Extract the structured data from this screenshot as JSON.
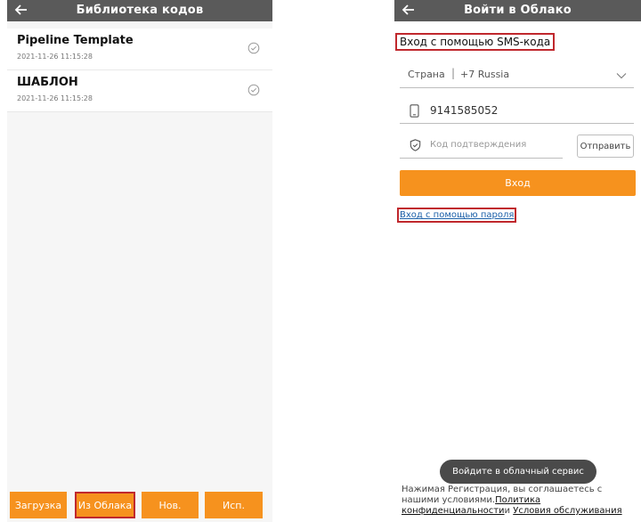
{
  "left": {
    "header": {
      "title": "Библиотека кодов"
    },
    "items": [
      {
        "title": "Pipeline Template",
        "date": "2021-11-26 11:15:28"
      },
      {
        "title": "ШАБЛОН",
        "date": "2021-11-26 11:15:28"
      }
    ],
    "buttons": {
      "load": "Загрузка",
      "from_cloud": "Из Облака",
      "new": "Нов.",
      "use": "Исп."
    },
    "colors": {
      "accent": "#f6921e",
      "header_bg": "#5a5a5a",
      "highlight": "#c0282d"
    }
  },
  "right": {
    "header": {
      "title": "Войти в Облако"
    },
    "sms_title": "Вход с помощью SMS-кода",
    "country": {
      "label": "Страна",
      "separator": "|",
      "value": "+7 Russia"
    },
    "phone": {
      "value": "9141585052"
    },
    "code": {
      "placeholder": "Код подтверждения"
    },
    "send_button": "Отправить",
    "login_button": "Вход",
    "password_link": "Вход с помощью пароля",
    "toast": "Войдите в облачный сервис",
    "terms": {
      "prefix": "Нажимая Регистрация, вы соглашаетесь с нашими условиями.",
      "privacy": "Политика конфиденциальности",
      "and": "и",
      "service": "Условия обслуживания"
    }
  }
}
